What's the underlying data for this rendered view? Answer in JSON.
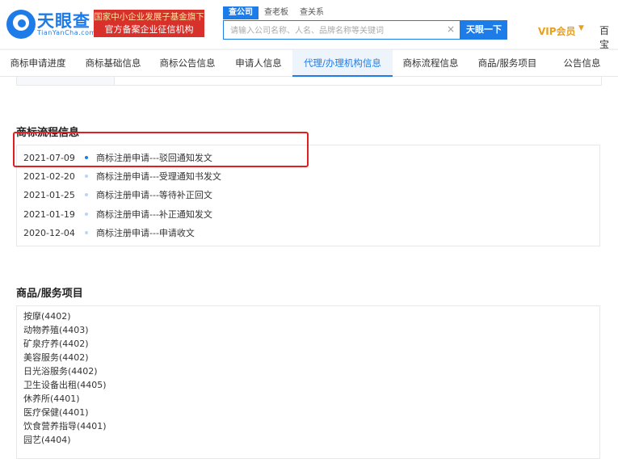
{
  "header": {
    "logo_name": "天眼查",
    "logo_sub": "TianYanCha.com",
    "gov_badge_line1": "国家中小企业发展子基金旗下",
    "gov_badge_line2": "官方备案企业征信机构",
    "search_tabs": [
      "查公司",
      "查老板",
      "查关系"
    ],
    "search_placeholder": "请输入公司名称、人名、品牌名称等关键词",
    "search_button": "天眼一下",
    "vip_label": "VIP会员",
    "baike_label": "百宝"
  },
  "tabs": [
    "商标申请进度",
    "商标基础信息",
    "商标公告信息",
    "申请人信息",
    "代理/办理机构信息",
    "商标流程信息",
    "商品/服务项目",
    "公告信息"
  ],
  "active_tab": "代理/办理机构信息",
  "flow_section": {
    "title": "商标流程信息",
    "rows": [
      {
        "date": "2021-07-09",
        "event": "商标注册申请---驳回通知发文"
      },
      {
        "date": "2021-02-20",
        "event": "商标注册申请---受理通知书发文"
      },
      {
        "date": "2021-01-25",
        "event": "商标注册申请---等待补正回文"
      },
      {
        "date": "2021-01-19",
        "event": "商标注册申请---补正通知发文"
      },
      {
        "date": "2020-12-04",
        "event": "商标注册申请---申请收文"
      }
    ]
  },
  "goods_section": {
    "title": "商品/服务项目",
    "items": [
      "按摩(4402)",
      "动物养殖(4403)",
      "矿泉疗养(4402)",
      "美容服务(4402)",
      "日光浴服务(4402)",
      "卫生设备出租(4405)",
      "休养所(4401)",
      "医疗保健(4401)",
      "饮食营养指导(4401)",
      "园艺(4404)"
    ]
  },
  "colors": {
    "brand": "#1e7ce8",
    "highlight": "#e02020",
    "vip": "#e8a020",
    "badge": "#d8302a"
  }
}
